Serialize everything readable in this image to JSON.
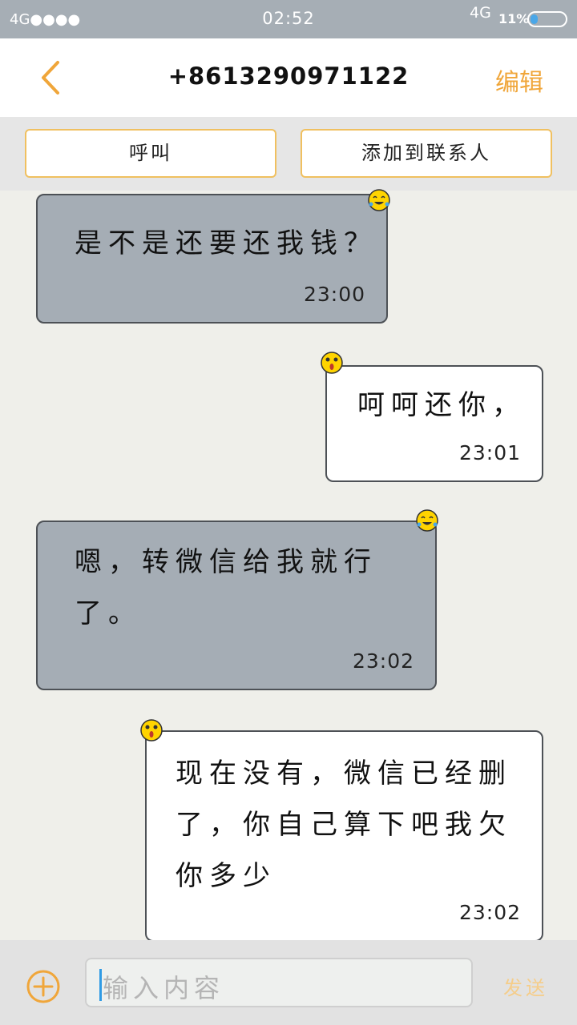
{
  "status_bar": {
    "signal": "4G●●●●",
    "time": "02:52",
    "network": "4G",
    "battery_text": "11%",
    "battery_level": 0.11
  },
  "header": {
    "back_icon": "chevron-left-icon",
    "title": "+8613290971122",
    "edit_label": "编辑"
  },
  "actions": {
    "call_label": "呼叫",
    "add_contact_label": "添加到联系人"
  },
  "messages": [
    {
      "direction": "in",
      "text": "是不是还要还我钱？",
      "time": "23:00",
      "emoji": "laughing-crying-emoji-icon"
    },
    {
      "direction": "out",
      "text": "呵呵还你，",
      "time": "23:01",
      "emoji": "surprised-emoji-icon"
    },
    {
      "direction": "in",
      "text": "嗯，转微信给我就行了。",
      "time": "23:02",
      "emoji": "laughing-crying-emoji-icon"
    },
    {
      "direction": "out",
      "text": "现在没有，微信已经删了，你自己算下吧我欠你多少",
      "time": "23:02",
      "emoji": "surprised-emoji-icon"
    }
  ],
  "input_bar": {
    "plus_icon": "plus-circle-icon",
    "placeholder": "输入内容",
    "send_label": "发送"
  },
  "colors": {
    "accent": "#f0a63a",
    "incoming_bubble": "#a5adb5",
    "outgoing_bubble": "#ffffff",
    "status_bar": "#a6aeb5",
    "background": "#efefea"
  }
}
